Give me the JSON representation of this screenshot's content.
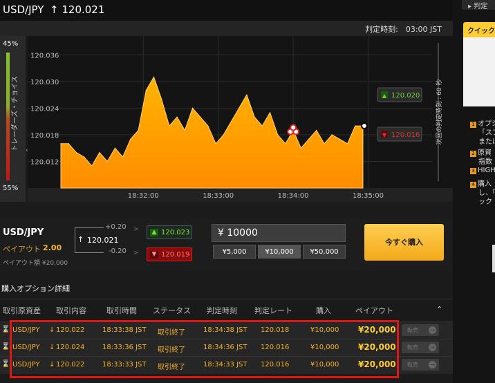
{
  "header": {
    "pair": "USD/JPY",
    "rate_arrow": "↑",
    "rate": "120.021"
  },
  "subheader": {
    "close_time": "判定時刻:　03:00 JST"
  },
  "gauge": {
    "top_pct": "45%",
    "bottom_pct": "55%",
    "label": "トレーダーズ・チョイス",
    "arrow": "‹",
    "high_fraction": 0.45
  },
  "chart": {
    "y_ticks": [
      "120.036",
      "120.030",
      "120.024",
      "120.018",
      "120.012"
    ],
    "x_ticks": [
      "18:32:00",
      "18:33:00",
      "18:34:00",
      "18:35:00"
    ],
    "high_tag": "120.020",
    "low_tag": "120.016",
    "next_close_label": "次回の判定時刻 : 60 秒",
    "colors": {
      "fill_top": "#ffb400",
      "fill_bottom": "#ff8c00",
      "high": "#6fd03a",
      "low": "#e03030"
    }
  },
  "chart_data": {
    "type": "area",
    "ylim": [
      120.006,
      120.039
    ],
    "x_minutes": [
      0,
      0.1,
      0.2,
      0.3,
      0.4,
      0.5,
      0.6,
      0.7,
      0.8,
      0.9,
      1.0,
      1.1,
      1.2,
      1.3,
      1.4,
      1.5,
      1.6,
      1.7,
      1.8,
      1.9,
      2.0,
      2.1,
      2.2,
      2.3,
      2.4,
      2.5,
      2.6,
      2.7,
      2.8,
      2.9,
      3.0,
      3.1,
      3.2,
      3.3,
      3.4,
      3.5,
      3.6,
      3.7,
      3.8,
      3.9
    ],
    "values": [
      120.016,
      120.016,
      120.014,
      120.013,
      120.011,
      120.014,
      120.012,
      120.015,
      120.013,
      120.017,
      120.019,
      120.028,
      120.031,
      120.026,
      120.02,
      120.022,
      120.019,
      120.024,
      120.022,
      120.02,
      120.016,
      120.018,
      120.021,
      120.024,
      120.027,
      120.022,
      120.02,
      120.023,
      120.018,
      120.016,
      120.019,
      120.015,
      120.017,
      120.019,
      120.016,
      120.018,
      120.017,
      120.016,
      120.02,
      120.02
    ]
  },
  "order": {
    "pair": "USD/JPY",
    "payout_label": "ペイアウト",
    "payout_value": "2.00",
    "payout_amount": "ペイアウト額 ¥20,000",
    "spot_arrow": "↑",
    "spot_rate": "120.021",
    "plus_diff": "+0.20",
    "minus_diff": "-0.20",
    "high_rate": "120.023",
    "low_rate": "120.019",
    "amount": "¥ 10000",
    "presets": [
      "¥5,000",
      "¥10,000",
      "¥50,000"
    ],
    "buy_now": "今すぐ購入"
  },
  "details": {
    "title": "購入オプション詳細",
    "columns": [
      "取引原資産",
      "取引内容",
      "取引時間",
      "ステータス",
      "判定時刻",
      "判定レート",
      "購入",
      "ペイアウト"
    ],
    "collapse_icon": "⌃",
    "rows": [
      {
        "asset": "USD/JPY",
        "dir": "↓",
        "rate": "120.022",
        "time": "18:33:38 JST",
        "status": "取引終了",
        "close": "18:34:38 JST",
        "close_rate": "120.018",
        "stake": "¥10,000",
        "payout": "¥20,000",
        "sell": "転売"
      },
      {
        "asset": "USD/JPY",
        "dir": "↓",
        "rate": "120.024",
        "time": "18:33:36 JST",
        "status": "取引終了",
        "close": "18:34:36 JST",
        "close_rate": "120.016",
        "stake": "¥10,000",
        "payout": "¥20,000",
        "sell": "転売"
      },
      {
        "asset": "USD/JPY",
        "dir": "↓",
        "rate": "120.022",
        "time": "18:33:33 JST",
        "status": "取引終了",
        "close": "18:34:33 JST",
        "close_rate": "120.016",
        "stake": "¥10,000",
        "payout": "¥20,000",
        "sell": "転売"
      }
    ]
  },
  "sidebar": {
    "top_tab": "判定",
    "quick_tab": "クイック",
    "notes": [
      {
        "num": "1",
        "lines": [
          "オプシ",
          "「スプ",
          "または"
        ]
      },
      {
        "num": "2",
        "lines": [
          "原資",
          "指数"
        ]
      },
      {
        "num": "3",
        "lines": [
          "HIGH"
        ]
      },
      {
        "num": "4",
        "lines": [
          "購入",
          "し、「",
          "ック"
        ]
      }
    ]
  }
}
